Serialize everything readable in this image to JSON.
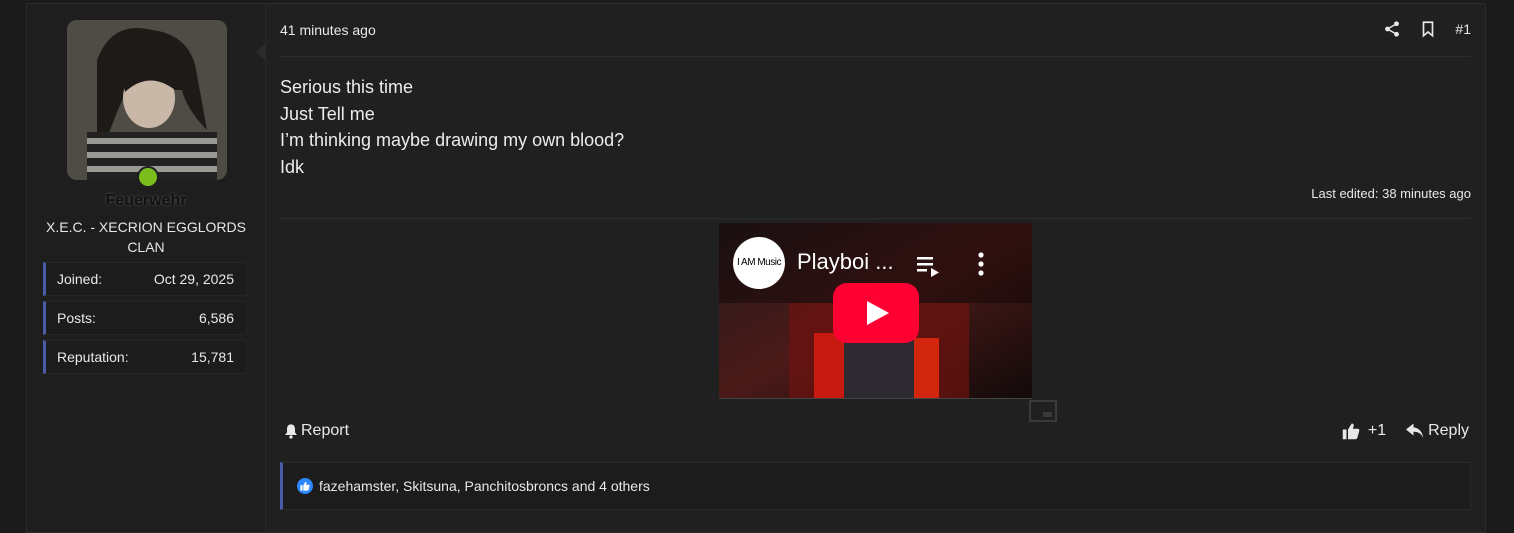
{
  "user": {
    "name": "Feuerwehr",
    "title": "X.E.C. - XECRION EGGLORDS CLAN",
    "online": true,
    "stats": [
      {
        "label": "Joined:",
        "value": "Oct 29, 2025"
      },
      {
        "label": "Posts:",
        "value": "6,586"
      },
      {
        "label": "Reputation:",
        "value": "15,781"
      }
    ]
  },
  "post": {
    "time": "41 minutes ago",
    "number": "#1",
    "lines": [
      "Serious this time",
      "Just Tell me",
      "I’m thinking maybe drawing my own blood?",
      "Idk"
    ],
    "edited": "Last edited: 38 minutes ago",
    "video": {
      "channel": "I AM Music",
      "title": "Playboi ..."
    }
  },
  "actions": {
    "report": "Report",
    "like_count": "+1",
    "reply": "Reply"
  },
  "reactions": {
    "text": "fazehamster, Skitsuna, Panchitosbroncs and 4 others"
  },
  "colors": {
    "accent": "#4a5ba8",
    "online": "#7bbd1d",
    "youtube_red": "#ff0033",
    "like_blue": "#2d88ff"
  },
  "icons": [
    "share-icon",
    "bookmark-icon",
    "bell-icon",
    "thumbs-up-icon",
    "reply-icon",
    "playlist-icon",
    "more-vertical-icon",
    "play-icon",
    "pip-icon"
  ]
}
